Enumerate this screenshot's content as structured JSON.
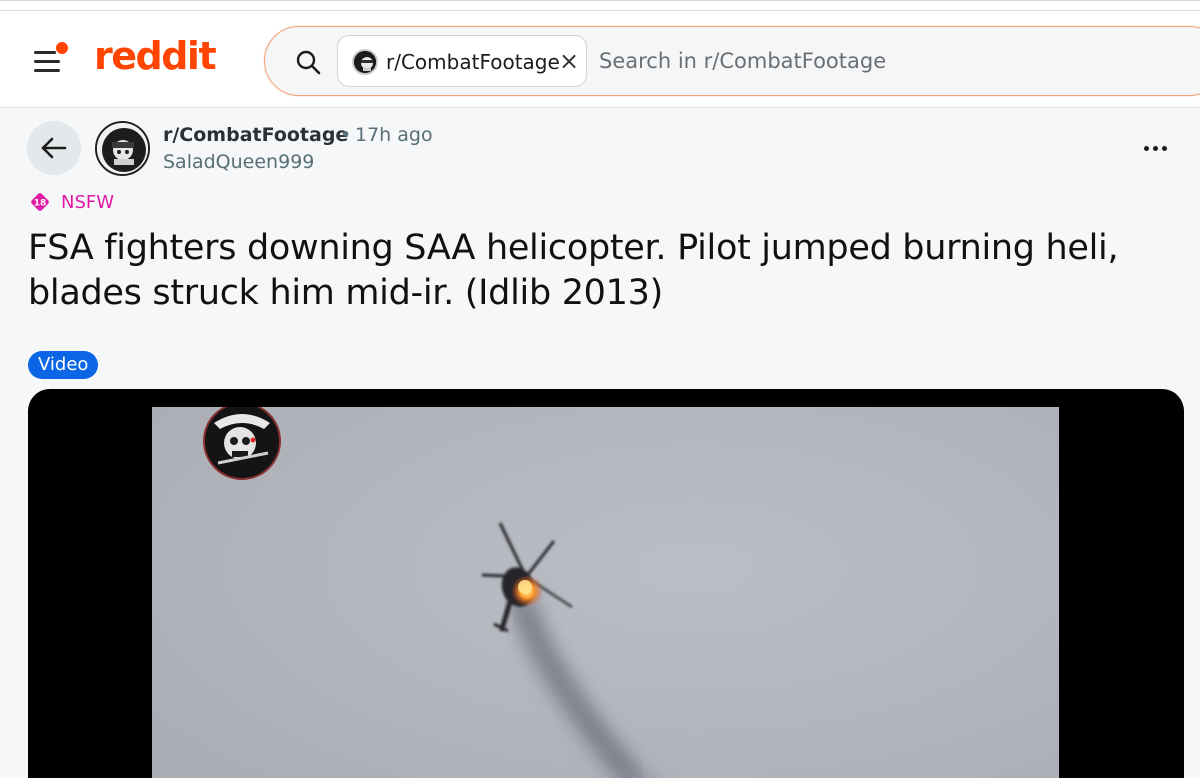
{
  "header": {
    "logo_text": "reddit",
    "brand_color": "#ff4500",
    "menu_icon": "hamburger-menu-icon"
  },
  "search": {
    "icon": "search-icon",
    "community_chip": "r/CombatFootage",
    "chip_close": "×",
    "placeholder": "Search in r/CombatFootage"
  },
  "post": {
    "subreddit": "r/CombatFootage",
    "separator": "•",
    "time": "17h ago",
    "author": "SaladQueen999",
    "nsfw_label": "NSFW",
    "nsfw_badge": "18",
    "title": "FSA fighters downing SAA helicopter. Pilot jumped burning heli, blades struck him mid-ir. (Idlib 2013)",
    "flair": "Video",
    "flair_color": "#0a66e4",
    "nsfw_color": "#e01aa4"
  }
}
